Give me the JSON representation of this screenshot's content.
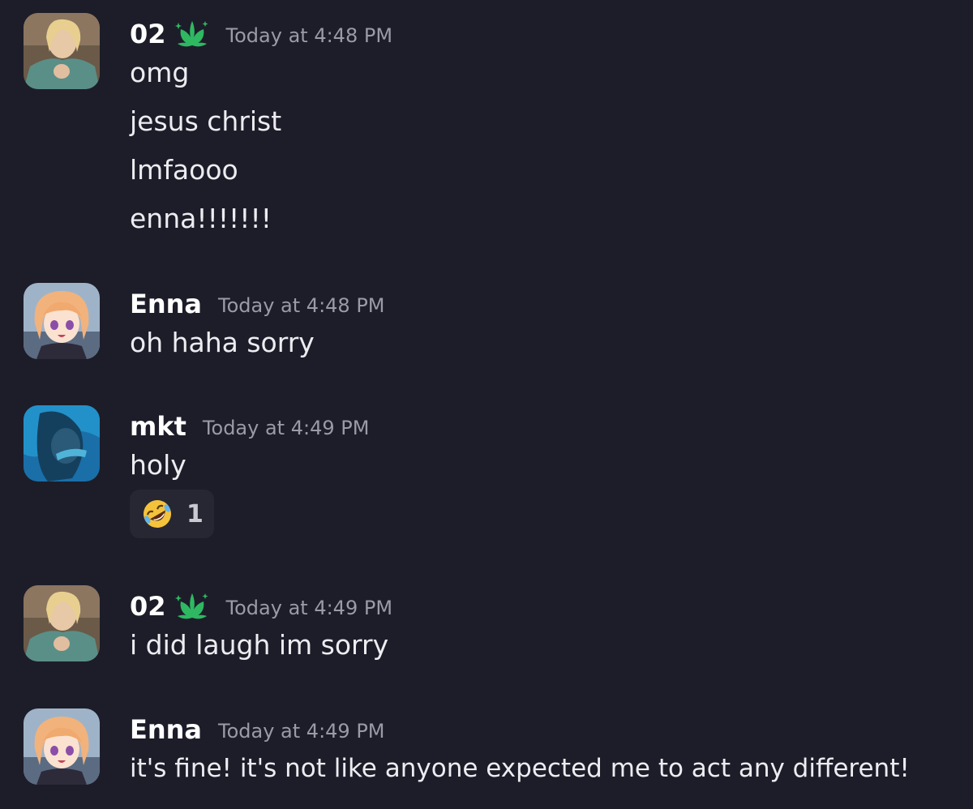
{
  "colors": {
    "background": "#1d1d29",
    "role_icon": "#2fb862",
    "timestamp": "#9a9aa8",
    "reaction_bg": "#272733"
  },
  "messages": [
    {
      "username": "02",
      "role_icon": "lotus-badge-icon",
      "timestamp": "Today at 4:48 PM",
      "lines": [
        "omg",
        "jesus christ",
        "lmfaooo",
        "enna!!!!!!!"
      ]
    },
    {
      "username": "Enna",
      "timestamp": "Today at 4:48 PM",
      "lines": [
        "oh haha sorry"
      ]
    },
    {
      "username": "mkt",
      "timestamp": "Today at 4:49 PM",
      "lines": [
        "holy"
      ],
      "reaction": {
        "emoji": "rolling-on-floor-laughing-emoji",
        "count": "1"
      }
    },
    {
      "username": "02",
      "role_icon": "lotus-badge-icon",
      "timestamp": "Today at 4:49 PM",
      "lines": [
        "i did laugh im sorry"
      ]
    },
    {
      "username": "Enna",
      "timestamp": "Today at 4:49 PM",
      "lines": [
        "it's fine! it's not like anyone expected me to act any different!"
      ]
    }
  ]
}
